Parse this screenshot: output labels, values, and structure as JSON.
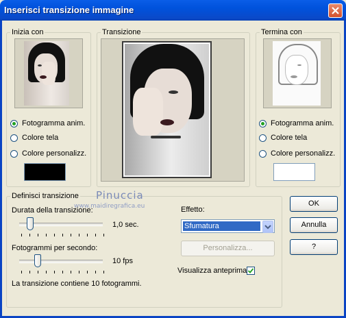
{
  "window": {
    "title": "Inserisci transizione immagine"
  },
  "groups": {
    "start": "Inizia con",
    "transition": "Transizione",
    "end": "Termina con",
    "define": "Definisci transizione"
  },
  "start_options": [
    "Fotogramma anim.",
    "Colore tela",
    "Colore personalizz."
  ],
  "start_selected": 0,
  "start_color": "#000000",
  "end_options": [
    "Fotogramma anim.",
    "Colore tela",
    "Colore personalizz."
  ],
  "end_selected": 0,
  "end_color": "#ffffff",
  "duration": {
    "label": "Durata della transizione:",
    "value_text": "1,0 sec.",
    "position": 0.1
  },
  "fps": {
    "label": "Fotogrammi per secondo:",
    "value_text": "10 fps",
    "position": 0.2
  },
  "info": "La transizione contiene 10 fotogrammi.",
  "effect": {
    "label": "Effetto:",
    "selected": "Sfumatura",
    "customize": "Personalizza..."
  },
  "preview": {
    "label": "Visualizza anteprima",
    "checked": true
  },
  "buttons": {
    "ok": "OK",
    "cancel": "Annulla",
    "help": "?"
  },
  "watermark": {
    "name": "Pinuccia",
    "url": "www.maidiregrafica.eu"
  }
}
